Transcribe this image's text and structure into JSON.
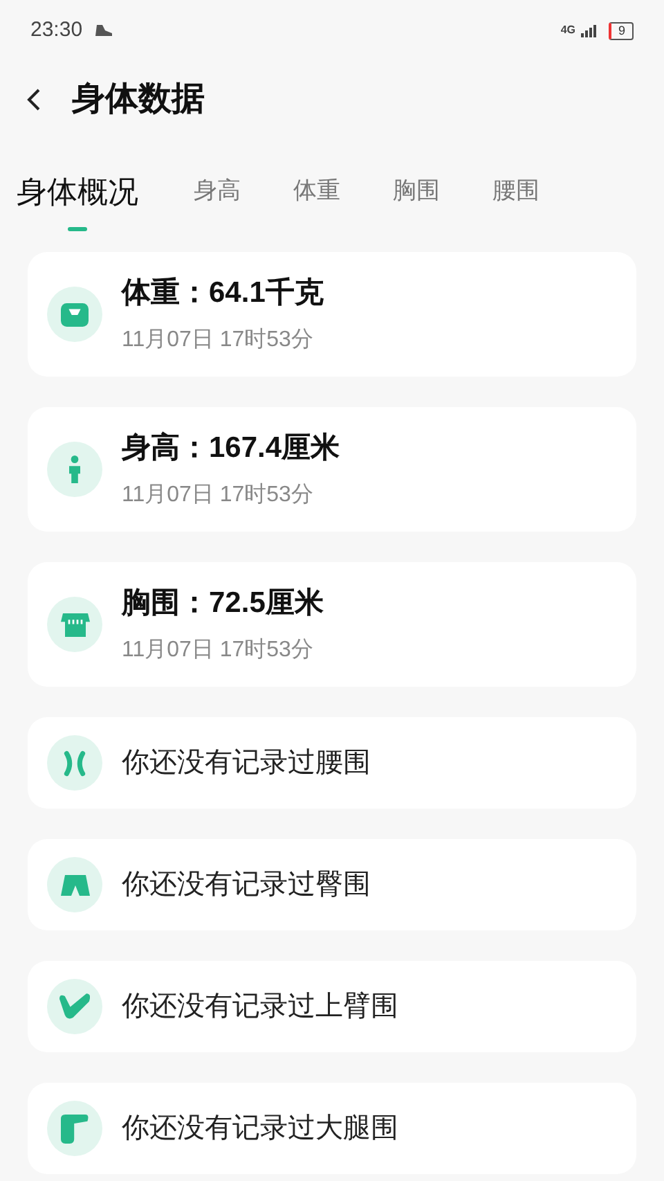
{
  "status_bar": {
    "time": "23:30",
    "network": "4G",
    "battery": "9"
  },
  "header": {
    "title": "身体数据"
  },
  "tabs": [
    {
      "label": "身体概况",
      "selected": true
    },
    {
      "label": "身高",
      "selected": false
    },
    {
      "label": "体重",
      "selected": false
    },
    {
      "label": "胸围",
      "selected": false
    },
    {
      "label": "腰围",
      "selected": false
    }
  ],
  "cards": [
    {
      "kind": "record",
      "title": "体重：64.1千克",
      "time": "11月07日 17时53分"
    },
    {
      "kind": "record",
      "title": "身高：167.4厘米",
      "time": "11月07日 17时53分"
    },
    {
      "kind": "record",
      "title": "胸围：72.5厘米",
      "time": "11月07日 17时53分"
    },
    {
      "kind": "empty",
      "title": "你还没有记录过腰围"
    },
    {
      "kind": "empty",
      "title": "你还没有记录过臀围"
    },
    {
      "kind": "empty",
      "title": "你还没有记录过上臂围"
    },
    {
      "kind": "empty",
      "title": "你还没有记录过大腿围"
    }
  ]
}
